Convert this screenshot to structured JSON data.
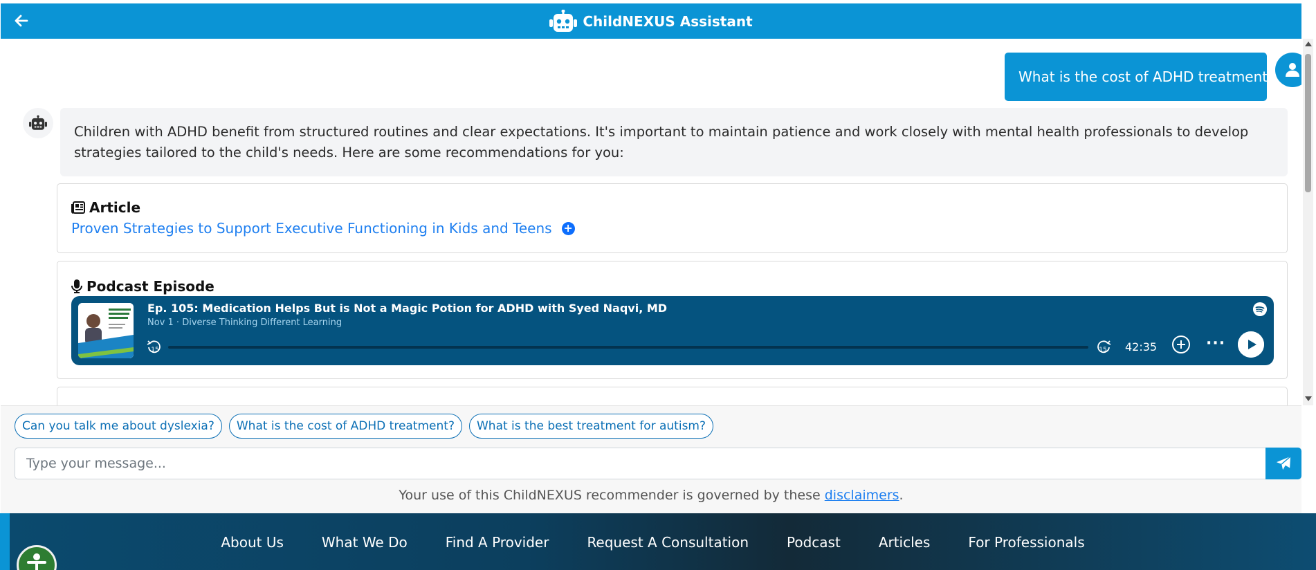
{
  "header": {
    "title": "ChildNEXUS Assistant",
    "back_icon": "arrow-left-icon",
    "robot_icon": "robot-icon",
    "color": "#0b94d5"
  },
  "chat": {
    "user_message": "What is the cost of ADHD treatment?",
    "bot_message": "Children with ADHD benefit from structured routines and clear expectations. It's important to maintain patience and work closely with mental health professionals to develop strategies tailored to the child's needs. Here are some recommendations for you:",
    "article": {
      "heading": "Article",
      "link_text": "Proven Strategies to Support Executive Functioning in Kids and Teens",
      "add_label": "+"
    },
    "podcast": {
      "heading": "Podcast Episode",
      "episode_title": "Ep. 105: Medication Helps But is Not a Magic Potion for ADHD with Syed Naqvi, MD",
      "date": "Nov 1",
      "separator": "·",
      "show": "Diverse Thinking Different Learning",
      "duration": "42:35",
      "rewind_label": "15",
      "forward_label": "15",
      "more_label": "···",
      "progress": 0,
      "cover_lines": [
        "Medication Helps",
        "But is Not a Magic",
        "Potion for ADHD"
      ],
      "cover_banner": [
        "Diverse Thinking",
        "Different Learning"
      ]
    }
  },
  "suggestions": [
    "Can you talk me about dyslexia?",
    "What is the cost of ADHD treatment?",
    "What is the best treatment for autism?"
  ],
  "input": {
    "placeholder": "Type your message..."
  },
  "disclaimer": {
    "prefix": "Your use of this ChildNEXUS recommender is governed by these ",
    "link": "disclaimers",
    "suffix": "."
  },
  "footer": {
    "nav": [
      "About Us",
      "What We Do",
      "Find A Provider",
      "Request A Consultation",
      "Podcast",
      "Articles",
      "For Professionals"
    ]
  }
}
